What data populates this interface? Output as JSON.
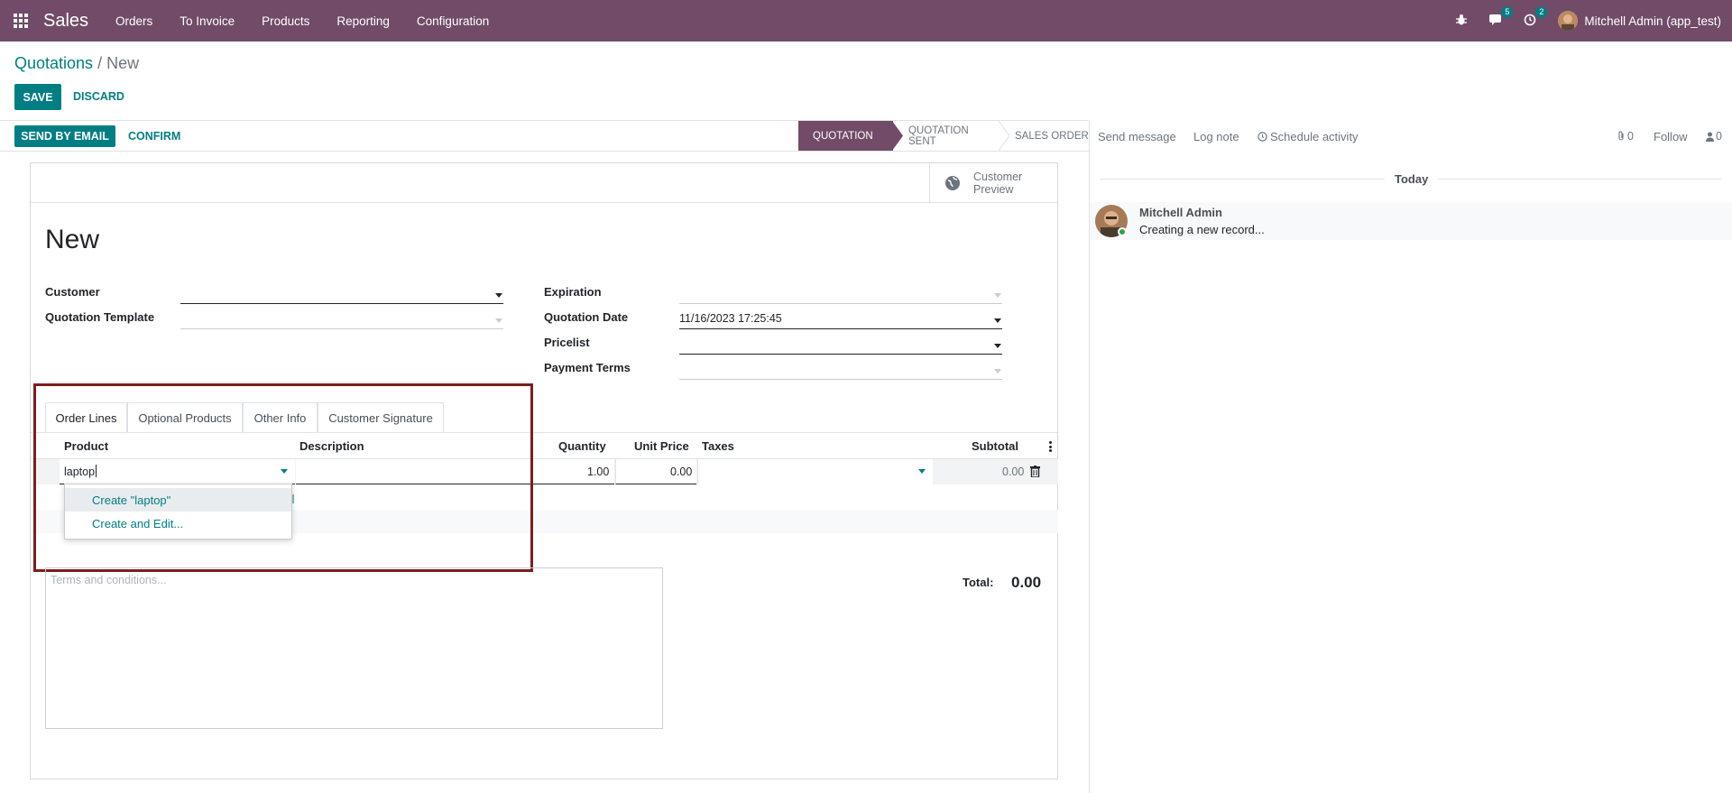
{
  "topbar": {
    "app_name": "Sales",
    "menu": [
      "Orders",
      "To Invoice",
      "Products",
      "Reporting",
      "Configuration"
    ],
    "messages_count": "5",
    "activities_count": "2",
    "user": "Mitchell Admin (app_test)"
  },
  "breadcrumb": {
    "parent": "Quotations",
    "separator": "/",
    "current": "New"
  },
  "actions": {
    "save": "SAVE",
    "discard": "DISCARD"
  },
  "header_buttons": {
    "send_email": "SEND BY EMAIL",
    "confirm": "CONFIRM"
  },
  "status_stages": [
    "QUOTATION",
    "QUOTATION SENT",
    "SALES ORDER"
  ],
  "customer_preview": {
    "line1": "Customer",
    "line2": "Preview"
  },
  "form": {
    "title": "New",
    "customer_label": "Customer",
    "template_label": "Quotation Template",
    "expiration_label": "Expiration",
    "date_label": "Quotation Date",
    "date_value": "11/16/2023 17:25:45",
    "pricelist_label": "Pricelist",
    "payment_terms_label": "Payment Terms"
  },
  "tabs": [
    "Order Lines",
    "Optional Products",
    "Other Info",
    "Customer Signature"
  ],
  "table": {
    "headers": {
      "product": "Product",
      "description": "Description",
      "quantity": "Quantity",
      "unit_price": "Unit Price",
      "taxes": "Taxes",
      "subtotal": "Subtotal"
    },
    "row": {
      "product": "laptop",
      "quantity": "1.00",
      "unit_price": "0.00",
      "subtotal": "0.00"
    }
  },
  "autocomplete": {
    "create": "Create \"laptop\"",
    "create_edit": "Create and Edit..."
  },
  "terms_placeholder": "Terms and conditions...",
  "total": {
    "label": "Total:",
    "value": "0.00"
  },
  "chatter": {
    "send_message": "Send message",
    "log_note": "Log note",
    "schedule_activity": "Schedule activity",
    "attachments_count": "0",
    "follow": "Follow",
    "followers_count": "0",
    "today": "Today",
    "author": "Mitchell Admin",
    "message": "Creating a new record..."
  },
  "colors": {
    "brand": "#714b67",
    "accent": "#017e84",
    "highlight": "#7a1f1f"
  }
}
